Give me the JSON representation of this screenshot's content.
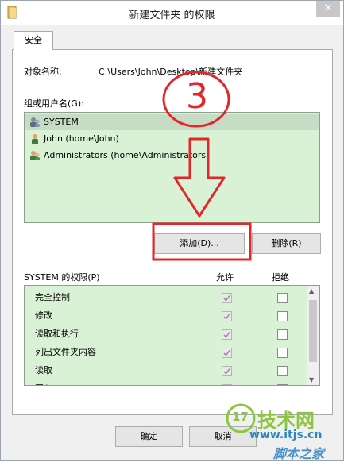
{
  "window": {
    "title": "新建文件夹 的权限",
    "close_glyph": "✕"
  },
  "tab": {
    "label": "安全"
  },
  "object": {
    "label": "对象名称:",
    "value": "C:\\Users\\John\\Desktop\\新建文件夹"
  },
  "groups": {
    "label": "组或用户名(G):",
    "items": [
      {
        "name": "SYSTEM",
        "selected": true
      },
      {
        "name": "John (home\\John)",
        "selected": false
      },
      {
        "name": "Administrators (home\\Administrators)",
        "selected": false
      }
    ]
  },
  "buttons": {
    "add": "添加(D)...",
    "remove": "删除(R)",
    "ok": "确定",
    "cancel": "取消"
  },
  "permissions": {
    "label": "SYSTEM 的权限(P)",
    "allow_header": "允许",
    "deny_header": "拒绝",
    "rows": [
      {
        "name": "完全控制",
        "allow": true,
        "deny": false
      },
      {
        "name": "修改",
        "allow": true,
        "deny": false
      },
      {
        "name": "读取和执行",
        "allow": true,
        "deny": false
      },
      {
        "name": "列出文件夹内容",
        "allow": true,
        "deny": false
      },
      {
        "name": "读取",
        "allow": true,
        "deny": false
      },
      {
        "name": "写入",
        "allow": true,
        "deny": false
      }
    ]
  },
  "annotation": {
    "step_number": "3",
    "color": "#e3262b"
  },
  "watermark": {
    "brand": "技术网",
    "url": "www.itjs.cn",
    "footer": "脚本之家",
    "logo_glyph": "17"
  }
}
